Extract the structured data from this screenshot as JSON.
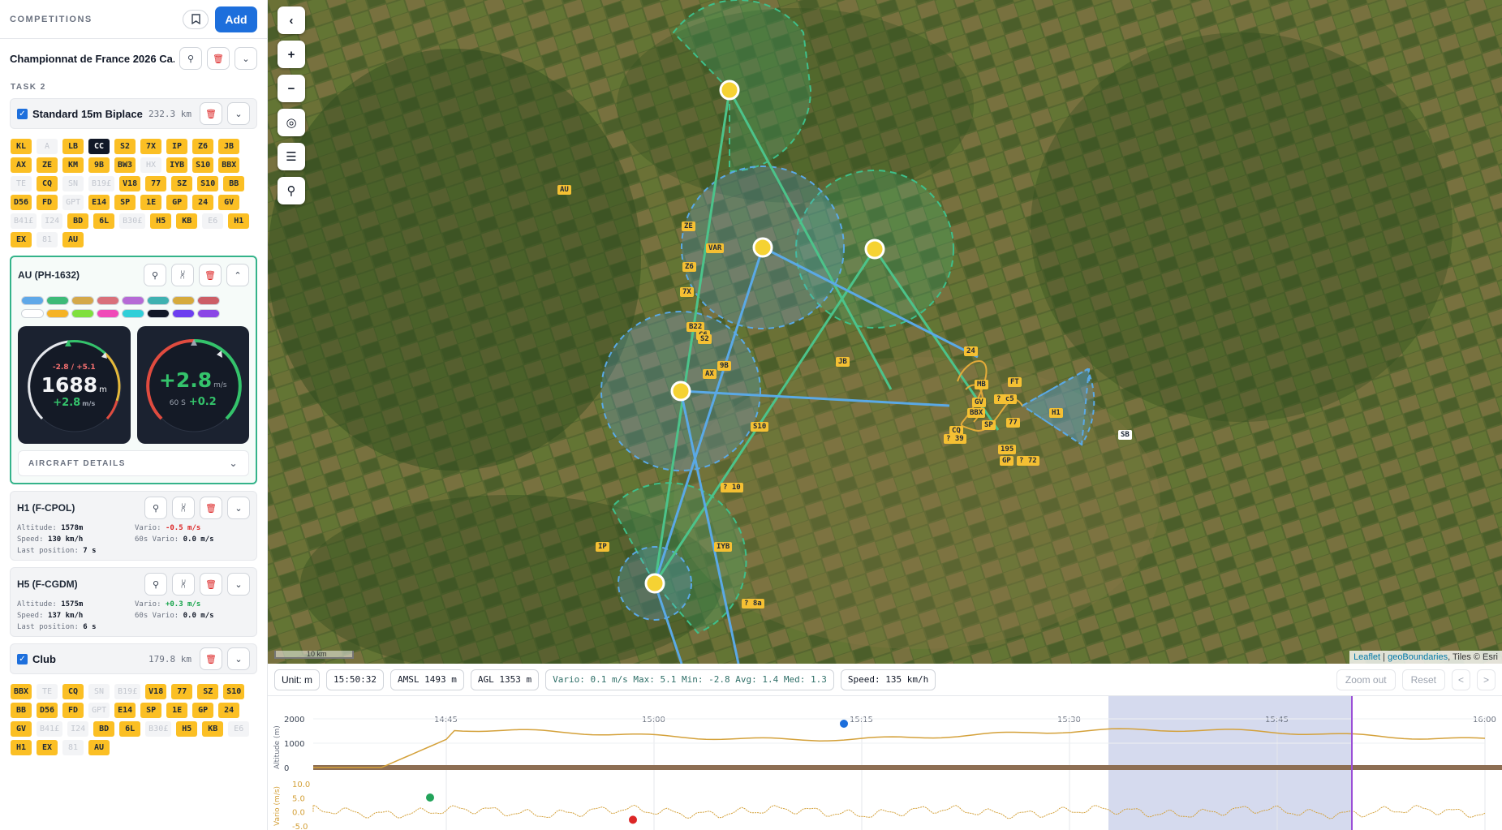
{
  "sidebar": {
    "title": "COMPETITIONS",
    "add_label": "Add",
    "competition_name": "Championnat de France 2026 Ca...",
    "task_label": "TASK 2",
    "class1": {
      "name": "Standard 15m Biplace",
      "distance": "232.3 km",
      "chips": [
        {
          "t": "KL",
          "s": "y"
        },
        {
          "t": "A",
          "s": "d"
        },
        {
          "t": "LB",
          "s": "y"
        },
        {
          "t": "CC",
          "s": "k"
        },
        {
          "t": "S2",
          "s": "y"
        },
        {
          "t": "7X",
          "s": "y"
        },
        {
          "t": "IP",
          "s": "y"
        },
        {
          "t": "Z6",
          "s": "y"
        },
        {
          "t": "JB",
          "s": "y"
        },
        {
          "t": "AX",
          "s": "y"
        },
        {
          "t": "ZE",
          "s": "y"
        },
        {
          "t": "KM",
          "s": "y"
        },
        {
          "t": "9B",
          "s": "y"
        },
        {
          "t": "BW3",
          "s": "y"
        },
        {
          "t": "HX",
          "s": "d"
        },
        {
          "t": "IYB",
          "s": "y"
        },
        {
          "t": "S10",
          "s": "y"
        },
        {
          "t": "BBX",
          "s": "y"
        },
        {
          "t": "TE",
          "s": "d"
        },
        {
          "t": "CQ",
          "s": "y"
        },
        {
          "t": "SN",
          "s": "d"
        },
        {
          "t": "B19£",
          "s": "d"
        },
        {
          "t": "V18",
          "s": "y"
        },
        {
          "t": "77",
          "s": "y"
        },
        {
          "t": "SZ",
          "s": "y"
        },
        {
          "t": "S10",
          "s": "y"
        },
        {
          "t": "BB",
          "s": "y"
        },
        {
          "t": "D56",
          "s": "y"
        },
        {
          "t": "FD",
          "s": "y"
        },
        {
          "t": "GPT",
          "s": "d"
        },
        {
          "t": "E14",
          "s": "y"
        },
        {
          "t": "SP",
          "s": "y"
        },
        {
          "t": "1E",
          "s": "y"
        },
        {
          "t": "GP",
          "s": "y"
        },
        {
          "t": "24",
          "s": "y"
        },
        {
          "t": "GV",
          "s": "y"
        },
        {
          "t": "B41£",
          "s": "d"
        },
        {
          "t": "I24",
          "s": "d"
        },
        {
          "t": "BD",
          "s": "y"
        },
        {
          "t": "6L",
          "s": "y"
        },
        {
          "t": "B30£",
          "s": "d"
        },
        {
          "t": "H5",
          "s": "y"
        },
        {
          "t": "KB",
          "s": "y"
        },
        {
          "t": "E6",
          "s": "d"
        },
        {
          "t": "H1",
          "s": "y"
        },
        {
          "t": "EX",
          "s": "y"
        },
        {
          "t": "81",
          "s": "d"
        },
        {
          "t": "AU",
          "s": "y"
        }
      ]
    },
    "aircraft_main": {
      "name": "AU (PH-1632)",
      "swatches": [
        "#5fa8e8",
        "#3dba78",
        "#d4a84a",
        "#d9707a",
        "#b66ad6",
        "#3fb1b1",
        "#d6aa3c",
        "#cc5e66",
        "#ffffff",
        "#f5b325",
        "#7fe03e",
        "#f04ab8",
        "#30cfd8",
        "#111827",
        "#6d3ff0",
        "#8b46e6"
      ],
      "gauge_alt": {
        "range": "-2.8 / +5.1",
        "value": "1688",
        "unit": "m",
        "vario": "+2.8",
        "vario_unit": "m/s"
      },
      "gauge_vario": {
        "value": "+2.8",
        "unit": "m/s",
        "avg_label": "60 S",
        "avg": "+0.2"
      },
      "details_label": "AIRCRAFT DETAILS"
    },
    "aircraft_h1": {
      "name": "H1 (F-CPOL)",
      "altitude_label": "Altitude:",
      "altitude": "1578m",
      "vario_label": "Vario:",
      "vario": "-0.5 m/s",
      "speed_label": "Speed:",
      "speed": "130 km/h",
      "vario60_label": "60s Vario:",
      "vario60": "0.0 m/s",
      "lastpos_label": "Last position:",
      "lastpos": "7 s"
    },
    "aircraft_h5": {
      "name": "H5 (F-CGDM)",
      "altitude_label": "Altitude:",
      "altitude": "1575m",
      "vario_label": "Vario:",
      "vario": "+0.3 m/s",
      "speed_label": "Speed:",
      "speed": "137 km/h",
      "vario60_label": "60s Vario:",
      "vario60": "0.0 m/s",
      "lastpos_label": "Last position:",
      "lastpos": "6 s"
    },
    "class2": {
      "name": "Club",
      "distance": "179.8 km",
      "chips": [
        {
          "t": "BBX",
          "s": "y"
        },
        {
          "t": "TE",
          "s": "d"
        },
        {
          "t": "CQ",
          "s": "y"
        },
        {
          "t": "SN",
          "s": "d"
        },
        {
          "t": "B19£",
          "s": "d"
        },
        {
          "t": "V18",
          "s": "y"
        },
        {
          "t": "77",
          "s": "y"
        },
        {
          "t": "SZ",
          "s": "y"
        },
        {
          "t": "S10",
          "s": "y"
        },
        {
          "t": "BB",
          "s": "y"
        },
        {
          "t": "D56",
          "s": "y"
        },
        {
          "t": "FD",
          "s": "y"
        },
        {
          "t": "GPT",
          "s": "d"
        },
        {
          "t": "E14",
          "s": "y"
        },
        {
          "t": "SP",
          "s": "y"
        },
        {
          "t": "1E",
          "s": "y"
        },
        {
          "t": "GP",
          "s": "y"
        },
        {
          "t": "24",
          "s": "y"
        },
        {
          "t": "GV",
          "s": "y"
        },
        {
          "t": "B41£",
          "s": "d"
        },
        {
          "t": "I24",
          "s": "d"
        },
        {
          "t": "BD",
          "s": "y"
        },
        {
          "t": "6L",
          "s": "y"
        },
        {
          "t": "B30£",
          "s": "d"
        },
        {
          "t": "H5",
          "s": "y"
        },
        {
          "t": "KB",
          "s": "y"
        },
        {
          "t": "E6",
          "s": "d"
        },
        {
          "t": "H1",
          "s": "y"
        },
        {
          "t": "EX",
          "s": "y"
        },
        {
          "t": "81",
          "s": "d"
        },
        {
          "t": "AU",
          "s": "y"
        }
      ]
    }
  },
  "map": {
    "scale_label": "10 km",
    "attribution": {
      "leaflet": "Leaflet",
      "sep": " | ",
      "geo": "geoBoundaries",
      "tiles": ", Tiles © Esri"
    },
    "glider_labels": [
      "AU",
      "ZE",
      "VAR",
      "Z6",
      "7X",
      "B22",
      "C6",
      "S2",
      "9B",
      "AX",
      "JB",
      "S10",
      "24",
      "MB",
      "FT",
      "GV",
      "BBX",
      "CQ",
      "SP",
      "77",
      "H1",
      "195",
      "GP",
      "? 72",
      "? 39",
      "? 10",
      "IYB",
      "IP",
      "? 8a",
      "SB",
      "? c5"
    ]
  },
  "toolbar": {
    "unit": "Unit: m",
    "time": "15:50:32",
    "amsl": "AMSL 1493 m",
    "agl": "AGL 1353 m",
    "vario": "Vario: 0.1 m/s Max: 5.1 Min: -2.8 Avg: 1.4 Med: 1.3",
    "speed": "Speed: 135 km/h",
    "zoom_out": "Zoom out",
    "reset": "Reset",
    "prev": "<",
    "next": ">"
  },
  "chart_data": {
    "type": "line",
    "x_ticks": [
      "14:45",
      "15:00",
      "15:15",
      "15:30",
      "15:45",
      "16:00"
    ],
    "altitude": {
      "ylabel": "Altitude (m)",
      "ticks": [
        "2000",
        "1000",
        "0"
      ],
      "ylim": [
        0,
        2000
      ]
    },
    "vario": {
      "ylabel": "Vario (m/s)",
      "ticks": [
        "10.0",
        "5.0",
        "0.0",
        "-5.0"
      ],
      "ylim": [
        -5,
        10
      ]
    }
  },
  "colors": {
    "accent": "#1d6fdc",
    "task_green": "#4cc38a",
    "track_blue": "#5aa9e6",
    "glider_yellow": "#f5c033"
  }
}
